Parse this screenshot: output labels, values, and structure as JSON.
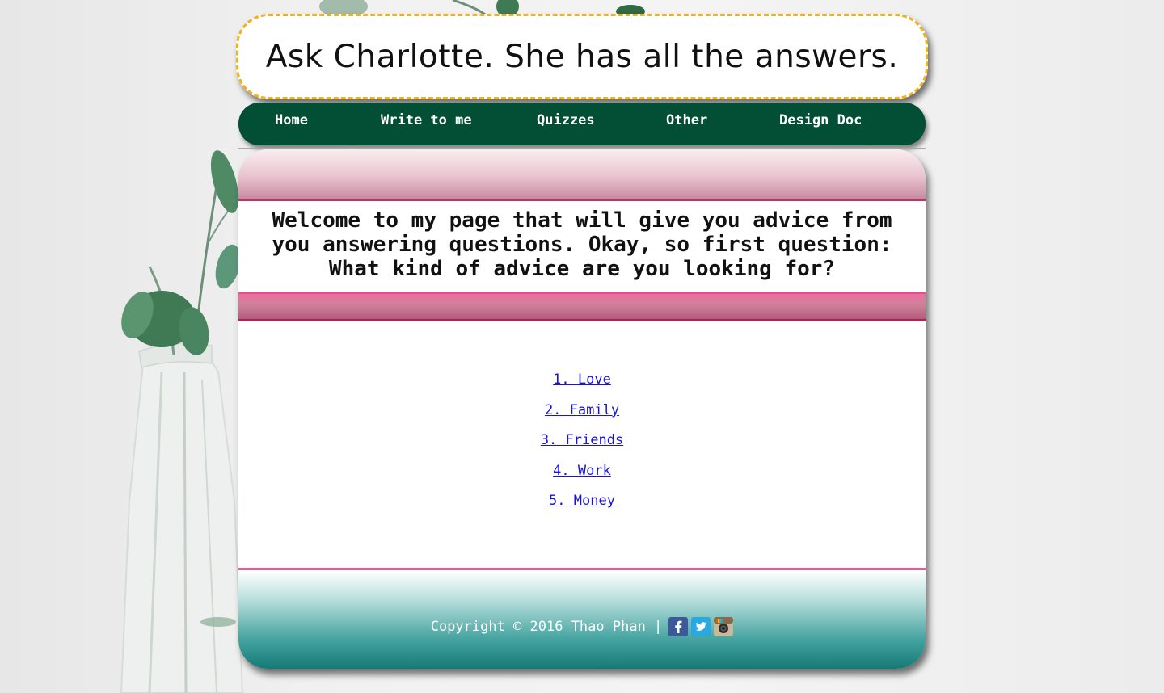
{
  "header": {
    "title": "Ask Charlotte. She has all the answers."
  },
  "nav": {
    "items": [
      {
        "label": "Home"
      },
      {
        "label": "Write to me"
      },
      {
        "label": "Quizzes"
      },
      {
        "label": "Other"
      },
      {
        "label": "Design Doc"
      }
    ]
  },
  "main": {
    "welcome": "Welcome to my page that will give you advice from you answering questions. Okay, so first question: What kind of advice are you looking for?",
    "topics": [
      {
        "label": "1. Love"
      },
      {
        "label": "2. Family"
      },
      {
        "label": "3. Friends"
      },
      {
        "label": "4. Work"
      },
      {
        "label": "5. Money"
      }
    ]
  },
  "footer": {
    "copyright": "Copyright © 2016 Thao Phan |",
    "social_icons": [
      "facebook-icon",
      "twitter-icon",
      "instagram-icon"
    ]
  },
  "colors": {
    "nav_bg": "#024f35",
    "banner_border": "#f2b21c",
    "link": "#1a13d6",
    "pink_accent": "#e8589a",
    "teal_footer": "#157a77"
  }
}
